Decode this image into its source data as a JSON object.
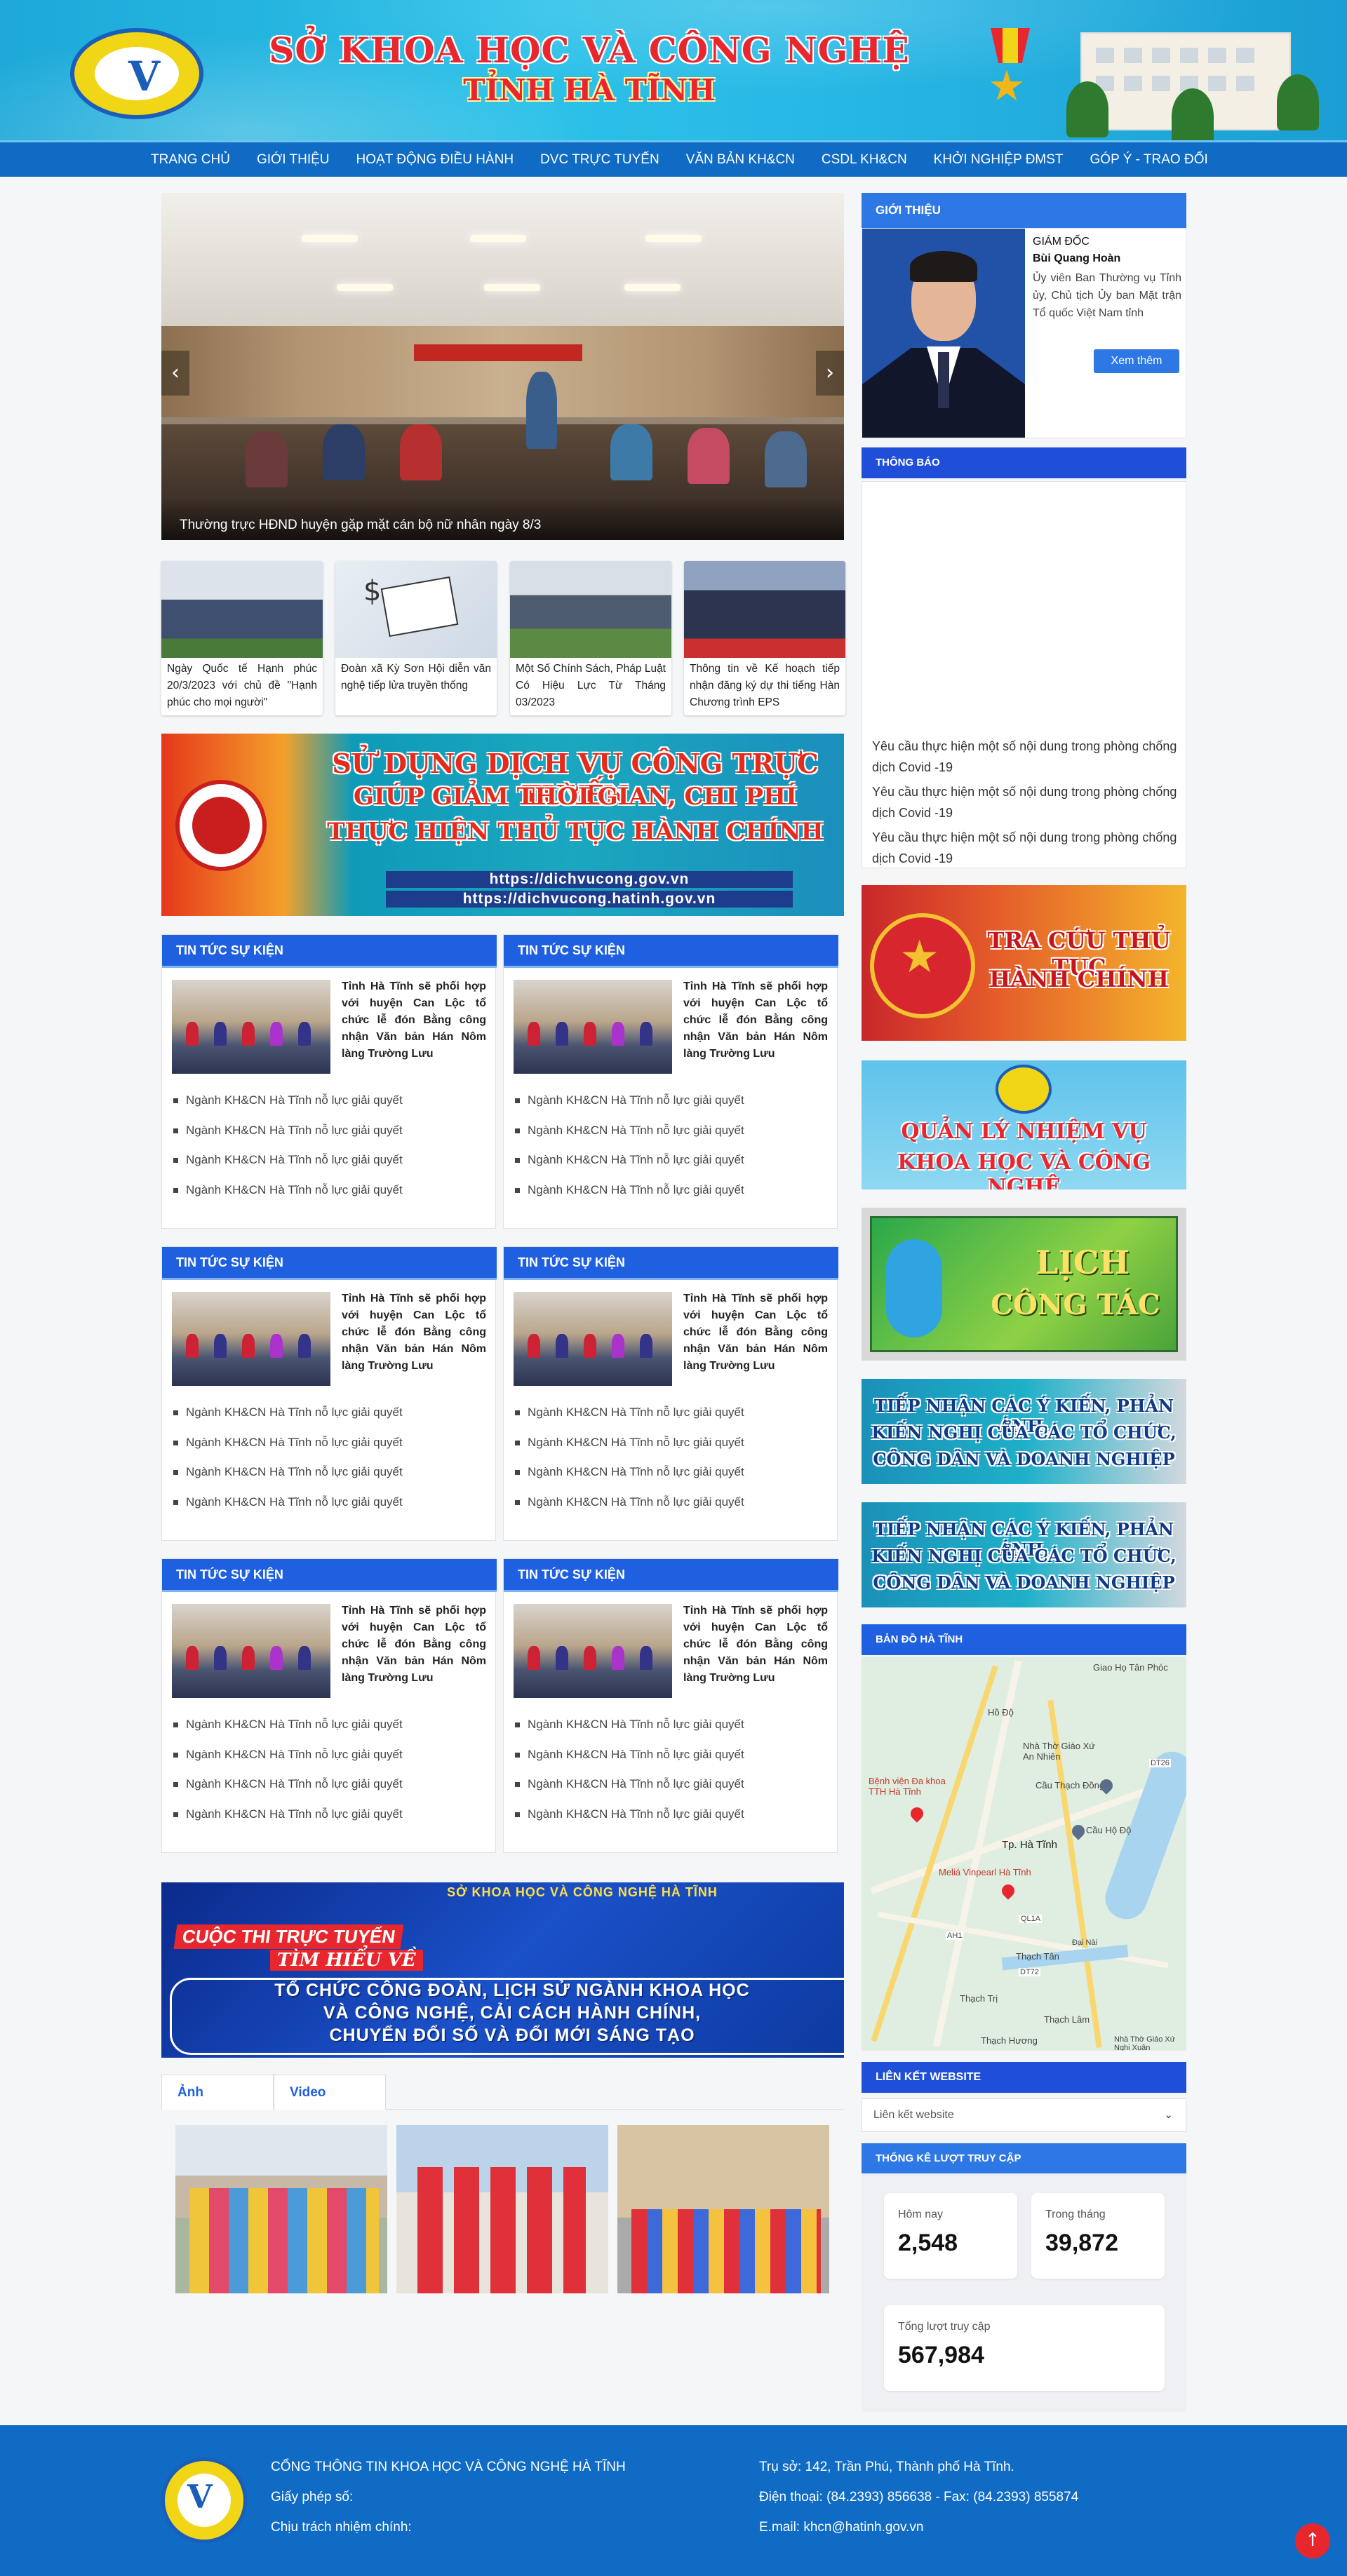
{
  "header": {
    "title_line1": "SỞ KHOA HỌC VÀ CÔNG NGHỆ",
    "title_line2": "TỈNH HÀ TĨNH"
  },
  "nav": {
    "items": [
      "TRANG CHỦ",
      "GIỚI THIỆU",
      "HOẠT ĐỘNG ĐIỀU HÀNH",
      "DVC TRỰC TUYẾN",
      "VĂN BẢN KH&CN",
      "CSDL KH&CN",
      "KHỞI NGHIỆP ĐMST",
      "GÓP Ý - TRAO ĐỔI"
    ]
  },
  "slider": {
    "caption": "Thường trực HĐND huyện gặp mặt cán bộ nữ nhân ngày 8/3",
    "prev": "‹",
    "next": "›"
  },
  "thumbs": [
    {
      "title": "Ngày Quốc tế Hạnh phúc 20/3/2023 với chủ đề \"Hạnh phúc cho mọi người\""
    },
    {
      "title": "Đoàn xã Kỳ Sơn Hội diễn văn nghệ tiếp lửa truyền thống"
    },
    {
      "title": "Một Số Chính Sách, Pháp Luật Có Hiệu Lực Từ Tháng 03/2023"
    },
    {
      "title": "Thông tin về Kế hoạch tiếp nhận đăng ký dự thi tiếng Hàn Chương trình EPS"
    }
  ],
  "banner_dvc": {
    "line1": "SỬ DỤNG DỊCH VỤ CÔNG TRỰC TUYẾN",
    "line2": "GIÚP GIẢM THỜI GIAN, CHI PHÍ",
    "line3": "THỰC HIỆN THỦ TỤC HÀNH CHÍNH",
    "url1": "https://dichvucong.gov.vn",
    "url2": "https://dichvucong.hatinh.gov.vn"
  },
  "news_blocks": {
    "heading": "TIN TỨC SỰ KIỆN",
    "lead": "Tỉnh Hà Tĩnh sẽ phối hợp với huyện Can Lộc tổ chức lễ đón Bằng công nhận Văn bản Hán Nôm làng Trường Lưu",
    "items": [
      "Ngành KH&CN Hà Tĩnh nỗ lực giải quyết",
      "Ngành KH&CN Hà Tĩnh nỗ lực giải quyết",
      "Ngành KH&CN Hà Tĩnh nỗ lực giải quyết",
      "Ngành KH&CN Hà Tĩnh nỗ lực giải quyết"
    ]
  },
  "banner_contest": {
    "top": "SỞ KHOA HỌC VÀ CÔNG NGHỆ HÀ TĨNH",
    "p1": "CUỘC THI TRỰC TUYẾN",
    "p2": "TÌM HIỂU VỀ",
    "l1": "TỔ CHỨC CÔNG ĐOÀN, LỊCH SỬ NGÀNH KHOA HỌC",
    "l2": "VÀ CÔNG NGHỆ, CẢI CÁCH HÀNH CHÍNH,",
    "l3": "CHUYỂN ĐỔI SỐ VÀ ĐỔI MỚI SÁNG TẠO"
  },
  "media_tabs": {
    "photo": "Ảnh",
    "video": "Video"
  },
  "sidebar": {
    "intro": {
      "heading": "GIỚI THIỆU",
      "role": "GIÁM ĐỐC",
      "name": "Bùi Quang Hoàn",
      "desc": "Ủy viên Ban Thường vụ Tỉnh ủy, Chủ tịch Ủy ban Mặt trận Tổ quốc Việt Nam tỉnh",
      "more": "Xem thêm"
    },
    "notice": {
      "heading": "THÔNG BÁO",
      "items": [
        "Yêu cầu thực hiện một số nội dung trong phòng chống dịch Covid -19",
        "Yêu cầu thực hiện một số nội dung trong phòng chống dịch Covid -19",
        "Yêu cầu thực hiện một số nội dung trong phòng chống dịch Covid -19"
      ]
    },
    "banner_tthc": {
      "line1": "TRA CỨU THỦ TỤC",
      "line2": "HÀNH CHÍNH"
    },
    "banner_qlnv": {
      "line1": "QUẢN LÝ NHIỆM VỤ",
      "line2": "KHOA HỌC VÀ CÔNG NGHỆ"
    },
    "banner_lich": {
      "line1": "LỊCH",
      "line2": "CÔNG TÁC"
    },
    "banner_ykien": {
      "line1": "TIẾP NHẬN CÁC Ý KIẾN, PHẢN ÁNH,",
      "line2": "KIẾN NGHỊ CỦA CÁC TỔ CHỨC,",
      "line3": "CÔNG DÂN VÀ DOANH NGHIỆP"
    },
    "map": {
      "heading": "BẢN ĐỒ HÀ TĨNH",
      "labels": [
        "Giao Họ Tân Phóc",
        "Hồ Độ",
        "Nhà Thờ Giáo Xứ An Nhiên",
        "Cầu Thạch Đồng",
        "Bệnh viện Đa khoa TTH Hà Tĩnh",
        "Tp. Hà Tĩnh",
        "Meliá Vinpearl Hà Tĩnh",
        "Cầu Hộ Độ",
        "Thạch Tân",
        "Thạch Trị",
        "Thạch Lâm",
        "Thạch Hương",
        "DT26",
        "QL1A",
        "DT72",
        "AH1",
        "Đại Nài",
        "Nhà Thờ Giáo Xứ Nghi Xuân"
      ]
    },
    "links": {
      "heading": "LIÊN KẾT WEBSITE",
      "placeholder": "Liên kết website",
      "chevron": "⌄"
    },
    "stats": {
      "heading": "THỐNG KÊ LƯỢT TRUY CẬP",
      "today_label": "Hôm nay",
      "today": "2,548",
      "month_label": "Trong tháng",
      "month": "39,872",
      "total_label": "Tổng lượt truy cập",
      "total": "567,984"
    }
  },
  "footer": {
    "org": "CỔNG THÔNG TIN KHOA HỌC VÀ CÔNG NGHỆ HÀ TĨNH",
    "license": "Giấy phép số:",
    "responsible": "Chịu trách nhiệm chính:",
    "address": "Trụ sở: 142, Trần Phú, Thành phố Hà Tĩnh.",
    "phone": "Điện thoại: (84.2393) 856638 - Fax: (84.2393) 855874",
    "email": "E.mail: khcn@hatinh.gov.vn",
    "to_top": "↑"
  },
  "colors": {
    "nav": "#0f6bc4",
    "section_header": "#1f60e0",
    "accent_red": "#e8262e"
  }
}
